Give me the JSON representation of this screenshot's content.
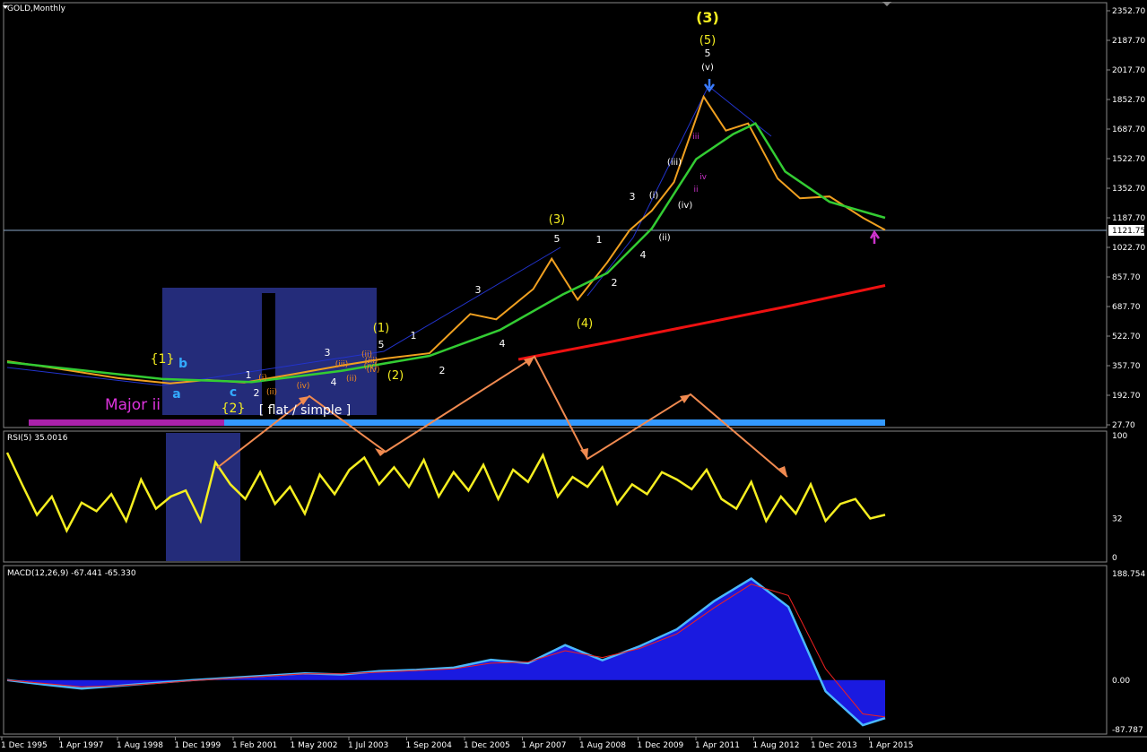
{
  "window": {
    "title": "GOLD,Monthly"
  },
  "chart_data": [
    {
      "type": "line",
      "title": "GOLD,Monthly",
      "ylim": [
        27.7,
        2352.7
      ],
      "y_scale": "log",
      "y_ticks": [
        "2352.70",
        "2187.70",
        "2017.70",
        "1852.70",
        "1687.70",
        "1522.70",
        "1352.70",
        "1187.70",
        "1022.70",
        "857.70",
        "687.70",
        "522.70",
        "357.70",
        "192.70",
        "27.70"
      ],
      "current_price": "1121.75",
      "x_ticks": [
        "1 Dec 1995",
        "1 Apr 1997",
        "1 Aug 1998",
        "1 Dec 1999",
        "1 Feb 2001",
        "1 May 2002",
        "1 Jul 2003",
        "1 Sep 2004",
        "1 Dec 2005",
        "1 Apr 2007",
        "1 Aug 2008",
        "1 Dec 2009",
        "1 Apr 2011",
        "1 Aug 2012",
        "1 Dec 2013",
        "1 Apr 2015"
      ],
      "series": [
        {
          "x": [
            "1995-12",
            "1997-01",
            "1998-06",
            "1999-08",
            "2000-06",
            "2001-04",
            "2002-06",
            "2003-06",
            "2004-06",
            "2005-06",
            "2006-05",
            "2006-12",
            "2007-10",
            "2008-03",
            "2008-10",
            "2009-06",
            "2009-12",
            "2010-06",
            "2010-12",
            "2011-08",
            "2012-02",
            "2012-08",
            "2013-04",
            "2013-10",
            "2014-06",
            "2015-03",
            "2015-09"
          ],
          "y": [
            385,
            345,
            290,
            260,
            280,
            265,
            315,
            360,
            400,
            430,
            650,
            620,
            790,
            960,
            730,
            940,
            1120,
            1230,
            1390,
            1870,
            1680,
            1720,
            1410,
            1300,
            1310,
            1190,
            1121.75
          ]
        },
        {
          "x": [
            "1995-12",
            "1999-06",
            "2001-06",
            "2003-06",
            "2005-06",
            "2007-01",
            "2008-06",
            "2009-06",
            "2010-06",
            "2011-06",
            "2012-04",
            "2012-10",
            "2013-06",
            "2014-06",
            "2015-09"
          ],
          "y": [
            380,
            285,
            268,
            330,
            415,
            560,
            760,
            880,
            1130,
            1520,
            1660,
            1720,
            1450,
            1280,
            1190
          ]
        },
        {
          "x": [
            "2007-06",
            "2009-06",
            "2011-06",
            "2013-06",
            "2015-09"
          ],
          "y": [
            395,
            490,
            590,
            690,
            810
          ]
        }
      ],
      "wave_labels": [
        "(3)",
        "(5)",
        "5",
        "(v)",
        "(3)",
        "5",
        "(1)",
        "5",
        "1",
        "3",
        "3",
        "1",
        "3",
        "(i)",
        "(iii)",
        "iii",
        "iv",
        "ii",
        "(iv)",
        "(ii)",
        "4",
        "2",
        "4",
        "2",
        "(2)",
        "(4)",
        "(i)",
        "(ii)",
        "(iii)",
        "(iv)",
        "{1}",
        "b",
        "a",
        "c",
        "1",
        "2",
        "(ii)",
        "(iv)",
        "4",
        "(ii)",
        "(iii)",
        "(iv)",
        "{2}",
        "Major ii",
        "[ flat / simple ]"
      ]
    },
    {
      "type": "line",
      "title": "RSI(5) 35.0016",
      "ylim": [
        0,
        100
      ],
      "y_ticks": [
        "100",
        "32",
        "0"
      ],
      "series": [
        {
          "x_index": [
            0,
            4,
            8,
            12,
            16,
            20,
            24,
            28,
            32,
            36,
            40,
            44,
            48,
            52,
            56,
            60,
            64,
            68,
            72,
            76,
            80,
            84,
            88,
            92,
            96,
            100,
            104,
            108,
            112,
            116,
            120,
            124,
            128,
            132,
            136,
            140,
            144,
            148,
            152,
            156,
            160,
            164,
            168,
            172,
            176,
            180,
            184,
            188,
            192,
            196,
            200,
            204,
            208,
            212,
            216,
            220,
            224,
            228,
            232,
            236
          ],
          "y": [
            86,
            60,
            35,
            50,
            22,
            45,
            38,
            52,
            30,
            64,
            40,
            50,
            55,
            30,
            78,
            60,
            48,
            70,
            44,
            58,
            36,
            68,
            52,
            72,
            82,
            60,
            74,
            58,
            80,
            50,
            70,
            55,
            76,
            48,
            72,
            62,
            84,
            50,
            66,
            58,
            74,
            44,
            60,
            52,
            70,
            64,
            56,
            72,
            48,
            40,
            62,
            30,
            50,
            36,
            60,
            30,
            44,
            48,
            32,
            35
          ]
        }
      ]
    },
    {
      "type": "area",
      "title": "MACD(12,26,9) -67.441 -65.330",
      "ylim": [
        -87.787,
        188.754
      ],
      "y_ticks": [
        "188.754",
        "0.00",
        "-87.787"
      ],
      "series": [
        {
          "x_index": [
            0,
            10,
            20,
            30,
            40,
            50,
            60,
            70,
            80,
            90,
            100,
            110,
            120,
            130,
            140,
            150,
            160,
            170,
            180,
            190,
            200,
            210,
            220,
            230,
            236
          ],
          "y": [
            0,
            -8,
            -15,
            -10,
            -5,
            0,
            4,
            8,
            12,
            10,
            16,
            18,
            22,
            36,
            30,
            62,
            35,
            60,
            90,
            140,
            180,
            130,
            -20,
            -80,
            -67.441
          ]
        },
        {
          "x_index": [
            0,
            10,
            20,
            30,
            40,
            50,
            60,
            70,
            80,
            90,
            100,
            110,
            120,
            130,
            140,
            150,
            160,
            170,
            180,
            190,
            200,
            210,
            220,
            230,
            236
          ],
          "y": [
            0,
            -6,
            -12,
            -10,
            -6,
            -1,
            3,
            7,
            11,
            11,
            14,
            17,
            20,
            30,
            32,
            52,
            40,
            56,
            82,
            128,
            170,
            150,
            20,
            -60,
            -65.33
          ]
        }
      ]
    }
  ]
}
